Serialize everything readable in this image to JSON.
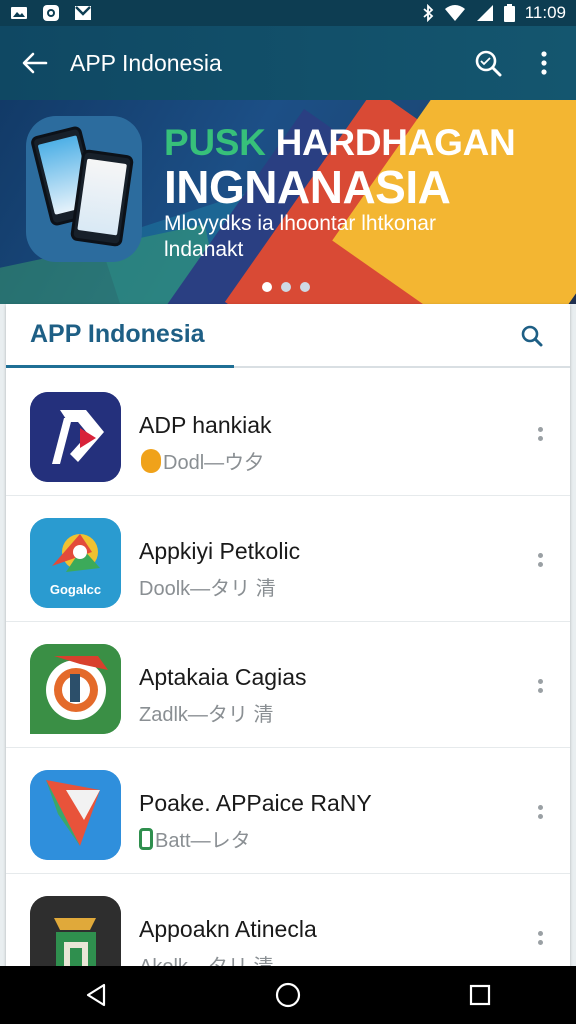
{
  "status_bar": {
    "left_icons": [
      "image-icon",
      "instagram-icon",
      "gmail-icon"
    ],
    "right_icons": [
      "bluetooth-icon",
      "wifi-icon",
      "signal-icon",
      "battery-icon"
    ],
    "time": "11:09"
  },
  "app_bar": {
    "title": "APP Indonesia",
    "actions": [
      "search-icon",
      "overflow-menu-icon"
    ]
  },
  "banner": {
    "headline_part1": "PUSK",
    "headline_part2": " HARDHAGAN",
    "headline_line2": "INGNANASIA",
    "subtitle_line1": "Mloyydks ia lhoontar lhtkonar",
    "subtitle_line2": "lndanakt",
    "pager": {
      "count": 3,
      "active": 0
    }
  },
  "tab": {
    "label": "APP  Indonesia",
    "search_icon": "search-icon"
  },
  "apps": [
    {
      "name": "ADP hankiak",
      "subtitle": "Dodl—ウ夕",
      "badge_color": "#f0a21a"
    },
    {
      "name": "Appkiyi Petkolic",
      "subtitle": "Doolk—タリ 清",
      "icon_text": "Gogalcc"
    },
    {
      "name": "Aptakaia Cagias",
      "subtitle": "Zadlk—タリ 清"
    },
    {
      "name": "Poake. APPaice RaNY",
      "subtitle": "Batt—レタ",
      "badge_color": "#2f8f4e"
    },
    {
      "name": "Appoakn Atinecla",
      "subtitle": "Akolk—タリ 清"
    }
  ],
  "colors": {
    "appbar": "#0f4863",
    "accent": "#1f6f95",
    "status_bar": "#0d3d52"
  }
}
